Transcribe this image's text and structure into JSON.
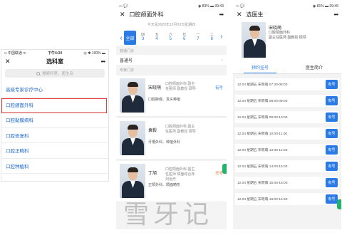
{
  "panel1": {
    "status": {
      "carrier": "▪▪ 中国联通 ≎",
      "time": "下午4:34",
      "battery": "◎ ✱ 100% ▬"
    },
    "title": "选科室",
    "search_placeholder": "搜索科室、医生名",
    "departments": [
      {
        "label": "高级专家诊疗中心",
        "highlighted": false
      },
      {
        "label": "口腔颌面外科",
        "highlighted": true
      },
      {
        "label": "口腔黏膜病科",
        "highlighted": false
      },
      {
        "label": "口腔修复科",
        "highlighted": false
      },
      {
        "label": "口腔正畸科",
        "highlighted": false
      },
      {
        "label": "口腔种植科",
        "highlighted": false
      }
    ]
  },
  "panel2": {
    "status": {
      "left": "▭ 💬",
      "right": "◉ 83% ▬ 09:43"
    },
    "title": "口腔颌面外科",
    "date_hint": "今天是2020年12月03日星期四",
    "all_label": "全部",
    "days": [
      {
        "weekday": "四",
        "num": "3"
      },
      {
        "weekday": "五",
        "num": "4"
      },
      {
        "weekday": "六",
        "num": "5"
      },
      {
        "weekday": "日",
        "num": "6"
      },
      {
        "weekday": "一",
        "num": "7"
      },
      {
        "weekday": "二",
        "num": "8"
      }
    ],
    "common_section": "普通门诊",
    "common_row": "普通号",
    "expert_section": "专家门诊",
    "doctors": [
      {
        "name": "宋晓萌",
        "title": "口腔颌面外科 副主任医师 副教授 硕导",
        "spec": "口腔肿瘤、发头种植",
        "avail": "有号"
      },
      {
        "name": "袁毅",
        "title": "口腔颌面外科 副主任医师 副教授 硕导",
        "spec": "牙槽外科、种植外科",
        "avail": ""
      },
      {
        "name": "丁旭",
        "title": "口腔颌面外科 副主任医师 颌面综合序列治疗",
        "spec": "正颌外科、颌面畸形",
        "avail": "无号"
      }
    ]
  },
  "panel3": {
    "status": {
      "left": "▭ 💬",
      "right": "◉ 81% ▬ 09:45"
    },
    "title": "选医生",
    "doctor": {
      "name": "宋晓萌",
      "dept": "口腔颌面外科",
      "rank": "副主任医师 副教授 硕导"
    },
    "tabs": [
      "预约挂号",
      "医生简介"
    ],
    "slots": [
      {
        "text": "12.04 星期五 宋晓萌 07:30-08:00",
        "btn": "有号"
      },
      {
        "text": "12.04 星期五 宋晓萌 08:00-09:00",
        "btn": "有号"
      },
      {
        "text": "12.04 星期五 宋晓萌 09:00-10:00",
        "btn": "有号"
      },
      {
        "text": "12.04 星期五 宋晓萌 10:00-11:00",
        "btn": "有号"
      },
      {
        "text": "12.04 星期五 宋晓萌 13:30-14:00",
        "btn": "有号"
      },
      {
        "text": "12.04 星期五 宋晓萌 14:00-15:00",
        "btn": "有号"
      },
      {
        "text": "12.04 星期五 宋晓萌 15:00-16:00",
        "btn": "有号"
      },
      {
        "text": "12.04 星期五 宋晓萌 16:00-16:30",
        "btn": "有号"
      }
    ]
  },
  "watermark": "雪牙记",
  "colors": {
    "accent": "#2b7be6",
    "highlight": "#e53935",
    "side_tab": "#21b36b"
  }
}
